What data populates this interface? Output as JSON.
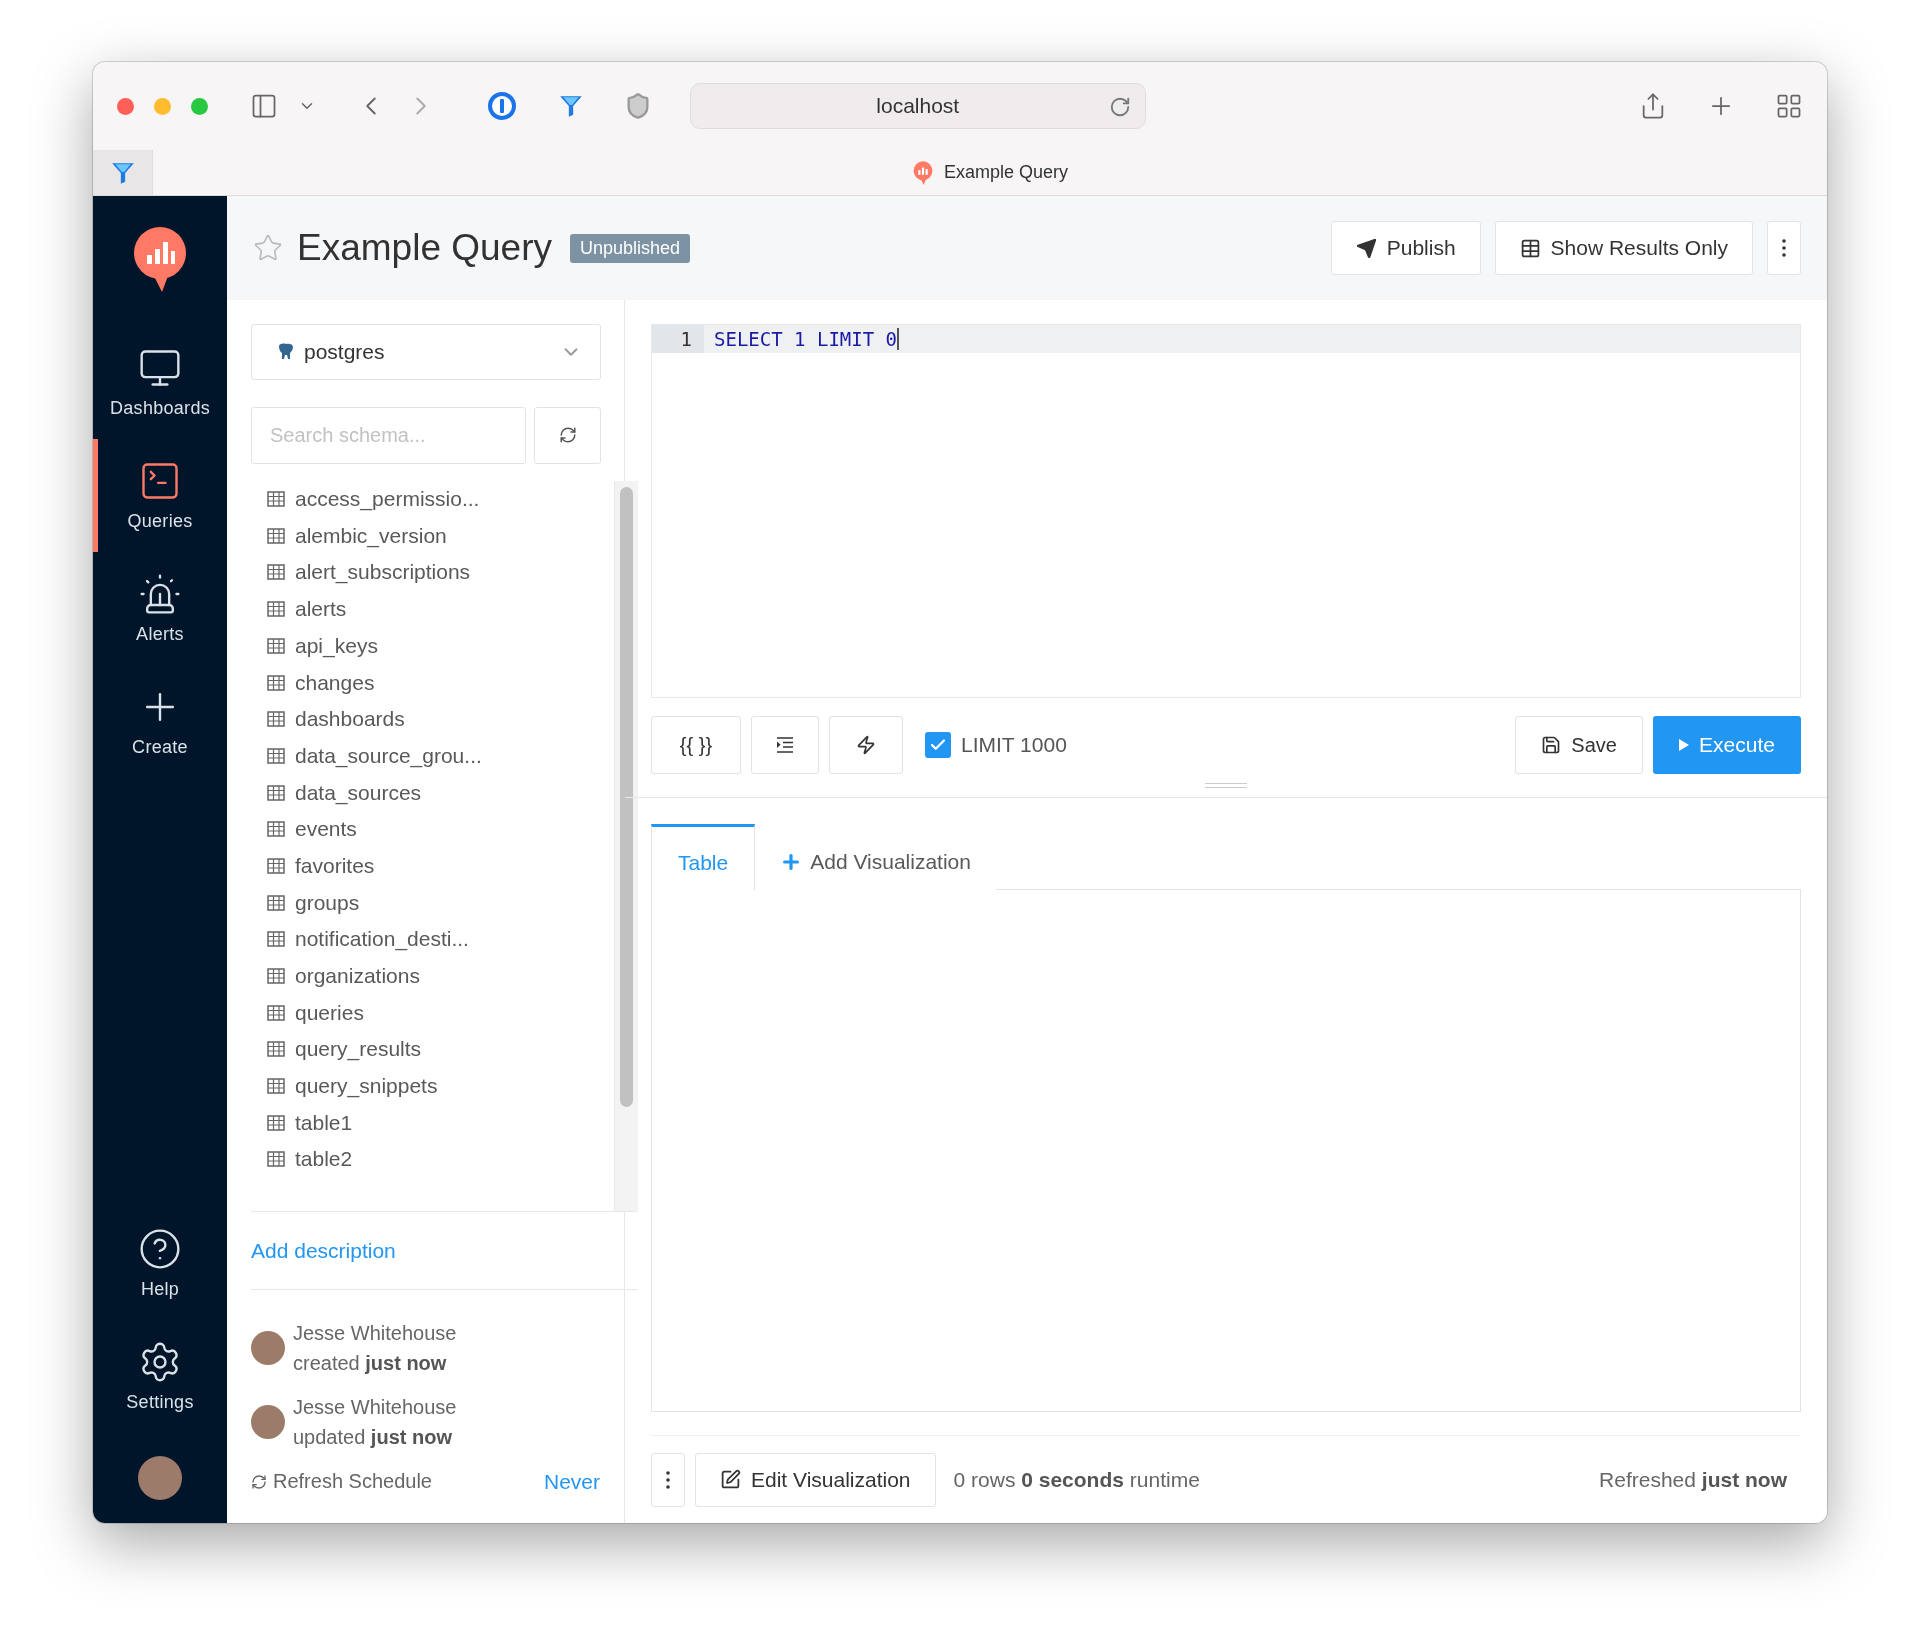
{
  "browser": {
    "address": "localhost",
    "tab_title": "Example Query"
  },
  "nav": [
    {
      "label": "Dashboards",
      "selected": false
    },
    {
      "label": "Queries",
      "selected": true
    },
    {
      "label": "Alerts",
      "selected": false
    },
    {
      "label": "Create",
      "selected": false
    }
  ],
  "nav_bottom": [
    {
      "label": "Help"
    },
    {
      "label": "Settings"
    }
  ],
  "query": {
    "title": "Example Query",
    "favorite": false,
    "status_badge": "Unpublished"
  },
  "header_buttons": [
    {
      "label": "Publish",
      "kind": "publish"
    },
    {
      "label": "Show Results Only",
      "kind": "results"
    }
  ],
  "data_source": {
    "value": "postgres"
  },
  "schema": {
    "placeholder": "Search schema...",
    "tables": [
      "access_permissio...",
      "alembic_version",
      "alert_subscriptions",
      "alerts",
      "api_keys",
      "changes",
      "dashboards",
      "data_source_grou...",
      "data_sources",
      "events",
      "favorites",
      "groups",
      "notification_desti...",
      "organizations",
      "queries",
      "query_results",
      "query_snippets",
      "table1",
      "table2"
    ]
  },
  "description_link": "Add description",
  "activity": [
    {
      "user": "Jesse Whitehouse",
      "text": "created **just now**"
    },
    {
      "user": "Jesse Whitehouse",
      "text": "updated **just now**"
    }
  ],
  "refresh_schedule": {
    "label": "Refresh Schedule",
    "value": "Never"
  },
  "editor": {
    "lines": [
      {
        "number": "1",
        "code": "SELECT 1 LIMIT 0"
      }
    ]
  },
  "toolbar": {
    "buttons": [
      {
        "kind": "text",
        "label": "{{ }}"
      },
      {
        "kind": "format"
      },
      {
        "kind": "autocomplete"
      }
    ],
    "limit": {
      "label": "LIMIT 1000",
      "checked": true
    },
    "save": "Save",
    "execute": "Execute"
  },
  "result_tabs": [
    {
      "label": "Table",
      "kind": "tab",
      "selected": true
    },
    {
      "label": "Add Visualization",
      "kind": "add",
      "selected": false
    }
  ],
  "footer": {
    "edit": "Edit Visualization",
    "stats": "0 rows **0 seconds** runtime",
    "refreshed": "Refreshed **just now**"
  }
}
